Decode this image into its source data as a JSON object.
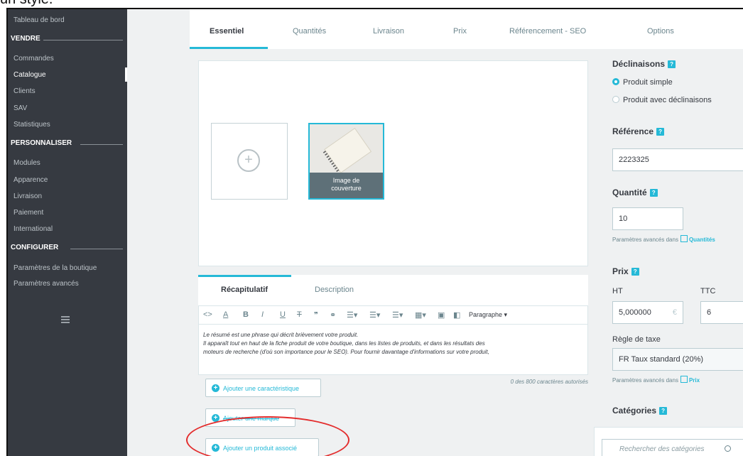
{
  "caption": "un style.",
  "sidebar": {
    "dashboard": "Tableau de bord",
    "section_sell": "VENDRE",
    "sell_items": [
      "Commandes",
      "Catalogue",
      "Clients",
      "SAV",
      "Statistiques"
    ],
    "section_customize": "PERSONNALISER",
    "customize_items": [
      "Modules",
      "Apparence",
      "Livraison",
      "Paiement",
      "International"
    ],
    "section_configure": "CONFIGURER",
    "configure_items": [
      "Paramètres de la boutique",
      "Paramètres avancés"
    ],
    "active_item": "Catalogue"
  },
  "tabs": [
    "Essentiel",
    "Quantités",
    "Livraison",
    "Prix",
    "Référencement - SEO",
    "Options"
  ],
  "active_tab": "Essentiel",
  "images": {
    "cover_label_line1": "Image de",
    "cover_label_line2": "couverture",
    "add_symbol": "+"
  },
  "summary": {
    "tab_summary": "Récapitulatif",
    "tab_description": "Description",
    "format_select": "Paragraphe",
    "text_line1": "Le résumé est une phrase qui décrit brièvement votre produit.",
    "text_line2": "Il apparaît tout en haut de la fiche produit de votre boutique, dans les listes de produits, et dans les résultats des",
    "text_line3": "moteurs de recherche (d'où son importance pour le SEO). Pour fournir davantage d'informations sur votre produit,",
    "char_count": "0 des 800 caractères autorisés"
  },
  "buttons": {
    "add_feature": "Ajouter une caractéristique",
    "add_brand": "Ajouter une marque",
    "add_related": "Ajouter un produit associé"
  },
  "right": {
    "combinations_title": "Déclinaisons",
    "simple_product": "Produit simple",
    "with_combinations": "Produit avec déclinaisons",
    "reference_title": "Référence",
    "reference_value": "2223325",
    "quantity_title": "Quantité",
    "quantity_value": "10",
    "advanced_in": "Paramètres avancés dans",
    "quantities_link": "Quantités",
    "price_title": "Prix",
    "ht_label": "HT",
    "ttc_label": "TTC",
    "ht_value": "5,000000",
    "currency": "€",
    "ttc_value": "6",
    "tax_rule_label": "Règle de taxe",
    "tax_rule_value": "FR Taux standard (20%)",
    "price_link": "Prix",
    "categories_title": "Catégories",
    "search_categories_placeholder": "Rechercher des catégories"
  },
  "colors": {
    "accent": "#25b9d7",
    "sidebar_bg": "#363a41",
    "annotation": "#e32d2d"
  }
}
